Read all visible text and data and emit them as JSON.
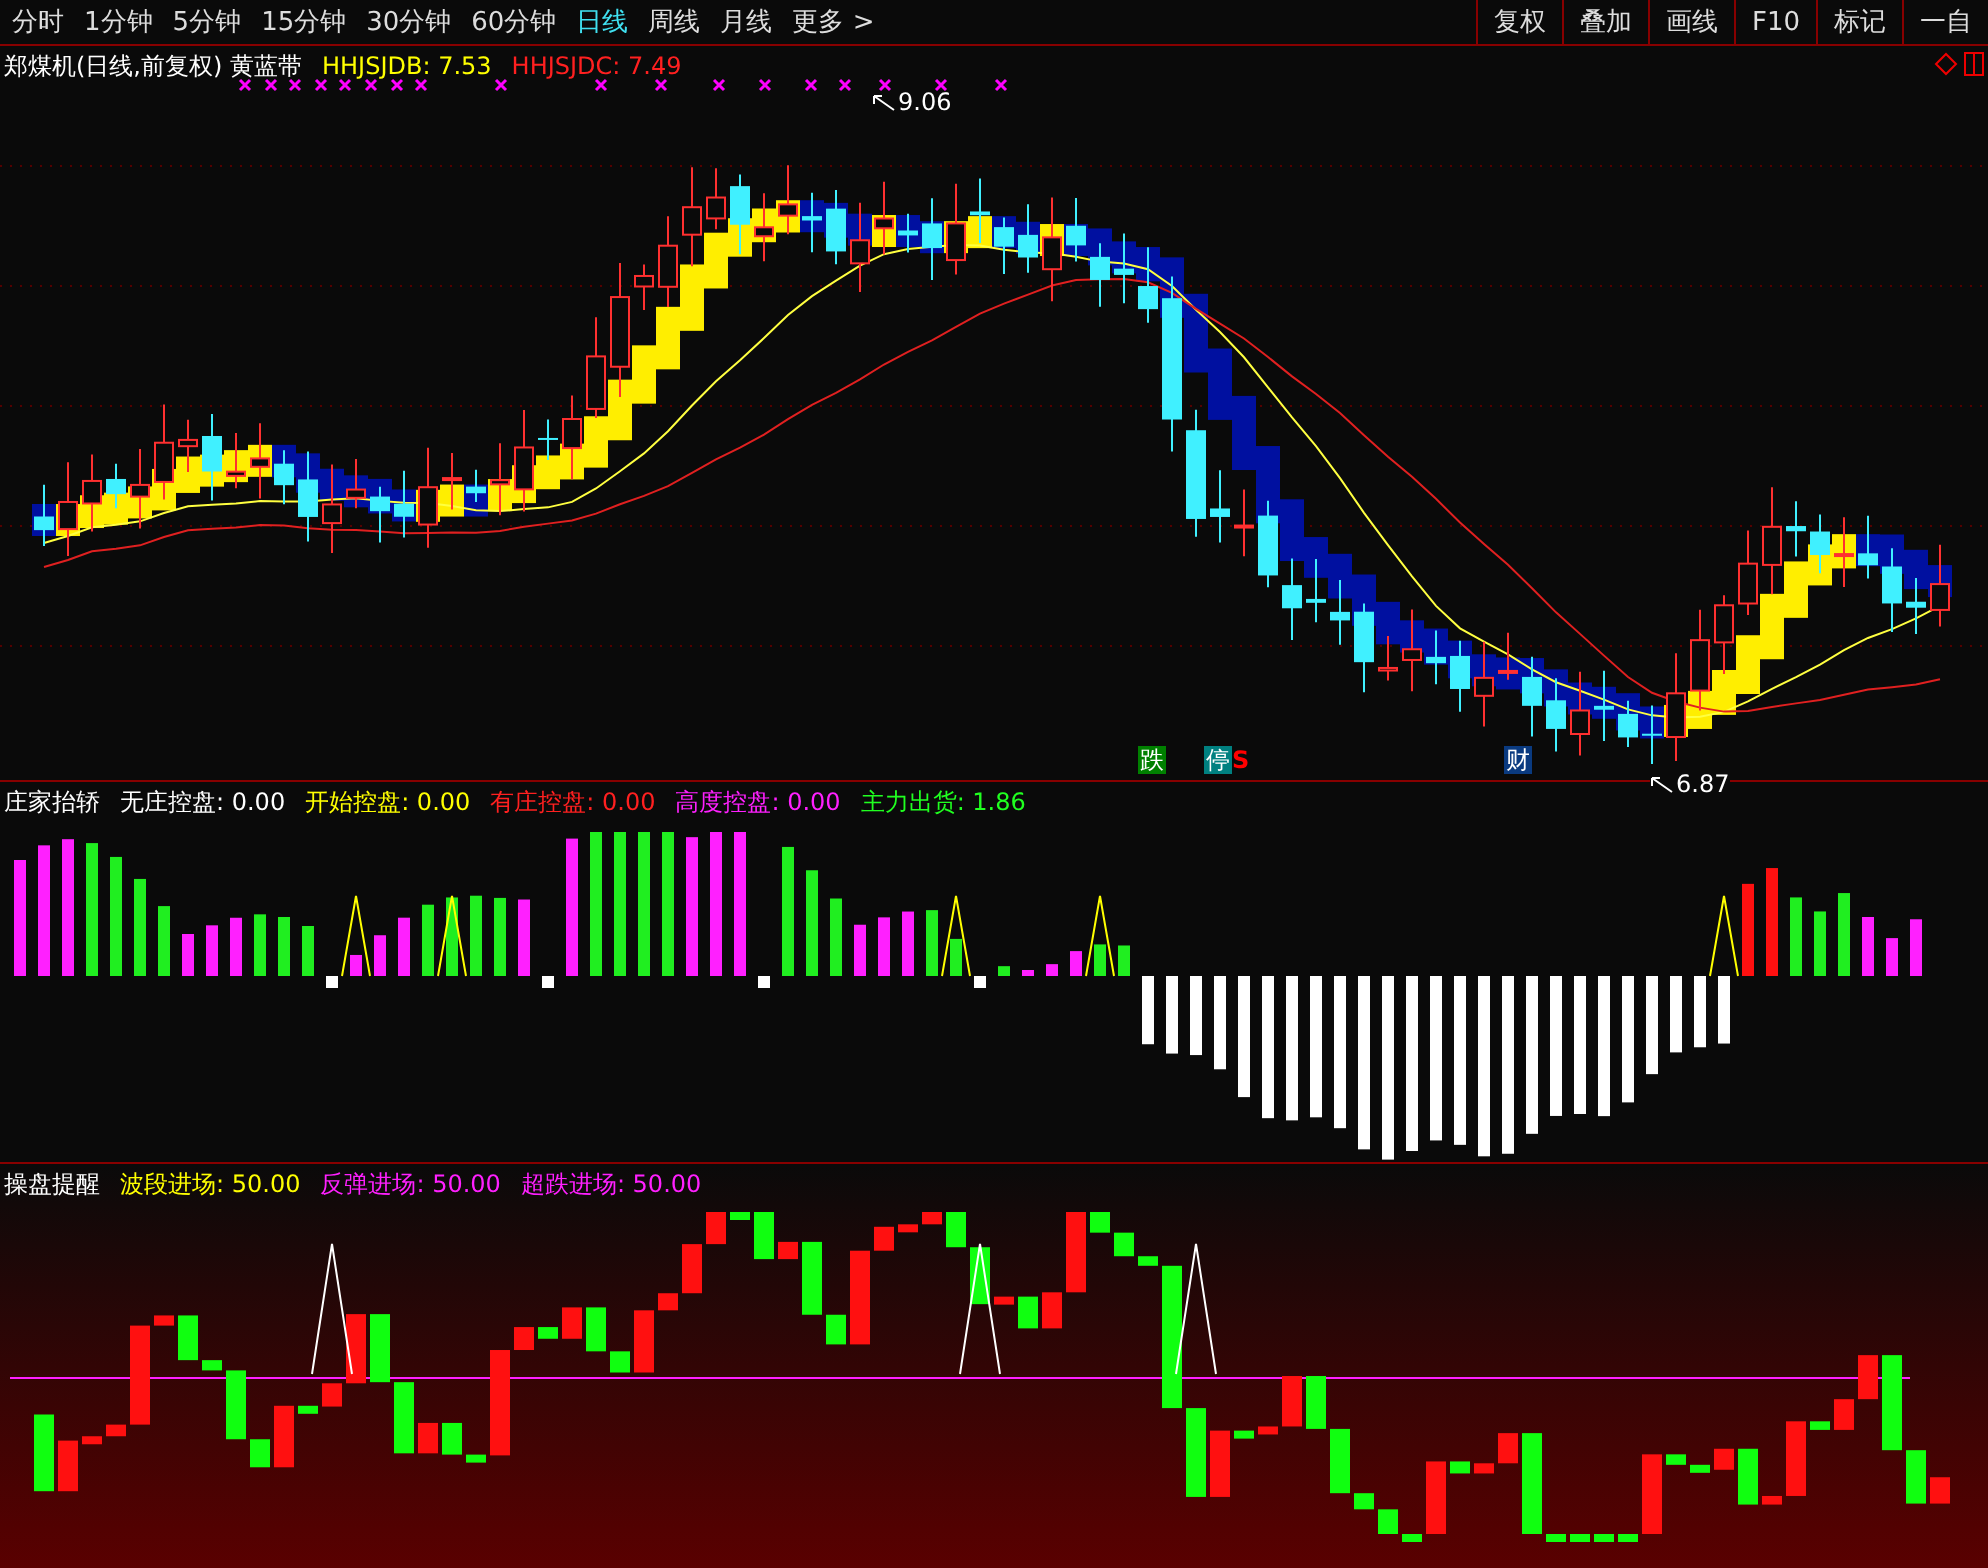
{
  "toolbar": {
    "periods": [
      {
        "label": "分时",
        "selected": false
      },
      {
        "label": "1分钟",
        "selected": false
      },
      {
        "label": "5分钟",
        "selected": false
      },
      {
        "label": "15分钟",
        "selected": false
      },
      {
        "label": "30分钟",
        "selected": false
      },
      {
        "label": "60分钟",
        "selected": false
      },
      {
        "label": "日线",
        "selected": true
      },
      {
        "label": "周线",
        "selected": false
      },
      {
        "label": "月线",
        "selected": false
      },
      {
        "label": "更多 >",
        "selected": false
      }
    ],
    "buttons": [
      "复权",
      "叠加",
      "画线",
      "F10",
      "标记",
      "一自"
    ]
  },
  "main_panel": {
    "title": "郑煤机(日线,前复权) 黄蓝带",
    "indicators": [
      {
        "label": "HHJSJDB: 7.53",
        "color": "#ffff00"
      },
      {
        "label": "HHJSJDC: 7.49",
        "color": "#ff2020"
      }
    ],
    "high_label": "9.06",
    "low_label": "6.87",
    "badges": [
      {
        "label": "跌",
        "color": "#008000"
      },
      {
        "label": "停",
        "color": "#008080"
      },
      {
        "label": "S",
        "color": "#ff0000"
      },
      {
        "label": "财",
        "color": "#0a3a80"
      }
    ]
  },
  "control_panel": {
    "title": "庄家抬轿",
    "indicators": [
      {
        "label": "无庄控盘: 0.00",
        "color": "#ffffff"
      },
      {
        "label": "开始控盘: 0.00",
        "color": "#ffff00"
      },
      {
        "label": "有庄控盘: 0.00",
        "color": "#ff2020"
      },
      {
        "label": "高度控盘: 0.00",
        "color": "#ff20ff"
      },
      {
        "label": "主力出货: 1.86",
        "color": "#20ff20"
      }
    ]
  },
  "alert_panel": {
    "title": "操盘提醒",
    "indicators": [
      {
        "label": "波段进场: 50.00",
        "color": "#ffff00"
      },
      {
        "label": "反弹进场: 50.00",
        "color": "#ff20ff"
      },
      {
        "label": "超跌进场: 50.00",
        "color": "#ff20ff"
      }
    ]
  }
}
